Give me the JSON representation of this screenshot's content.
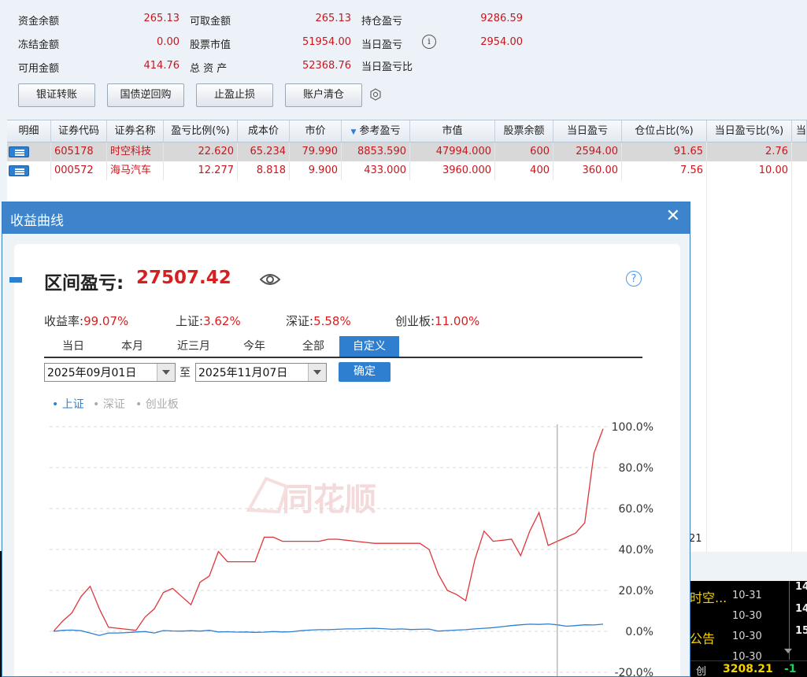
{
  "account": {
    "row1": [
      {
        "label": "资金余额",
        "value": "265.13"
      },
      {
        "label": "可取金额",
        "value": "265.13"
      },
      {
        "label": "持仓盈亏",
        "value": "9286.59"
      }
    ],
    "row2": [
      {
        "label": "冻结金额",
        "value": "0.00"
      },
      {
        "label": "股票市值",
        "value": "51954.00"
      },
      {
        "label": "当日盈亏",
        "value": "2954.00"
      }
    ],
    "row3": [
      {
        "label": "可用金额",
        "value": "414.76"
      },
      {
        "label": "总 资 产",
        "value": "52368.76"
      },
      {
        "label": "当日盈亏比",
        "value": ""
      }
    ],
    "info_symbol": "i"
  },
  "buttons": [
    "银证转账",
    "国债逆回购",
    "止盈止损",
    "账户清仓"
  ],
  "table": {
    "headers": [
      "明细",
      "证券代码",
      "证券名称",
      "盈亏比例(%)",
      "成本价",
      "市价",
      "参考盈亏",
      "市值",
      "股票余额",
      "当日盈亏",
      "仓位占比(%)",
      "当日盈亏比(%)",
      "当"
    ],
    "rows": [
      [
        "",
        "605178",
        "时空科技",
        "22.620",
        "65.234",
        "79.990",
        "8853.590",
        "47994.000",
        "600",
        "2594.00",
        "91.65",
        "2.76"
      ],
      [
        "",
        "000572",
        "海马汽车",
        "12.277",
        "8.818",
        "9.900",
        "433.000",
        "3960.000",
        "400",
        "360.00",
        "7.56",
        "10.00"
      ]
    ],
    "partial_cell": "21"
  },
  "market_panel": {
    "name": "时空...",
    "notice": "公告",
    "dates": [
      "10-31",
      "10-30",
      "10-30",
      "10-30"
    ],
    "side_digits": [
      "14",
      "14",
      "15"
    ],
    "index_label": "创",
    "index_value": "3208.21",
    "index_change": "-1"
  },
  "dialog": {
    "title": "收益曲线",
    "close": "✕",
    "pl_label": "区间盈亏:",
    "pl_value": "27507.42",
    "help": "?",
    "stats": [
      {
        "label": "收益率:",
        "value": "99.07%"
      },
      {
        "label": "上证:",
        "value": "3.62%"
      },
      {
        "label": "深证:",
        "value": "5.58%"
      },
      {
        "label": "创业板:",
        "value": "11.00%"
      }
    ],
    "tabs": [
      "当日",
      "本月",
      "近三月",
      "今年",
      "全部",
      "自定义"
    ],
    "active_tab": "自定义",
    "date_from": "2025年09月01日",
    "date_to": "2025年11月07日",
    "to_label": "至",
    "ok_label": "确定",
    "legend": [
      "上证",
      "深证",
      "创业板"
    ],
    "watermark": "同花顺"
  },
  "chart_data": {
    "type": "line",
    "y_ticks": [
      "100.0%",
      "80.0%",
      "60.0%",
      "40.0%",
      "20.0%",
      "0.0%",
      "-20.0%"
    ],
    "ylim": [
      -20,
      100
    ],
    "grid": true,
    "legend_position": "top-left",
    "series": [
      {
        "name": "收益率",
        "color": "#e0353a",
        "values": [
          0,
          5,
          9,
          17,
          22,
          11,
          2,
          1.5,
          1,
          0.5,
          7,
          11,
          19,
          21,
          17,
          13,
          24,
          27,
          39,
          34,
          34,
          34,
          34,
          46,
          46,
          44,
          44,
          44,
          44,
          44,
          45,
          45,
          44.5,
          44,
          43.5,
          43,
          43,
          43,
          43,
          43,
          43,
          40,
          28,
          20,
          18,
          15,
          35,
          49,
          44,
          44.5,
          45,
          37,
          49,
          58,
          42,
          44,
          46,
          48,
          53,
          87,
          99
        ]
      },
      {
        "name": "上证",
        "color": "#2f7fd0",
        "values": [
          0,
          0.5,
          0.6,
          0.3,
          -0.8,
          -2,
          -0.8,
          -0.8,
          -0.6,
          -0.3,
          -0.1,
          -0.8,
          0.4,
          0.2,
          0.1,
          0.3,
          0.1,
          0.5,
          -0.3,
          -0.2,
          -0.4,
          -0.3,
          -0.5,
          -0.4,
          -0.1,
          -0.3,
          -0.2,
          0.3,
          0.6,
          0.8,
          0.8,
          1,
          1.2,
          1.2,
          1.4,
          1.5,
          1.3,
          1,
          1.2,
          0.9,
          1,
          1.1,
          0.1,
          0.4,
          0.6,
          0.8,
          1.2,
          1.5,
          1.8,
          2.3,
          2.8,
          3.2,
          3.5,
          3.4,
          3.6,
          3.2,
          2.5,
          2.8,
          3.2,
          3.1,
          3.5
        ]
      }
    ],
    "highlight_index": 55
  }
}
